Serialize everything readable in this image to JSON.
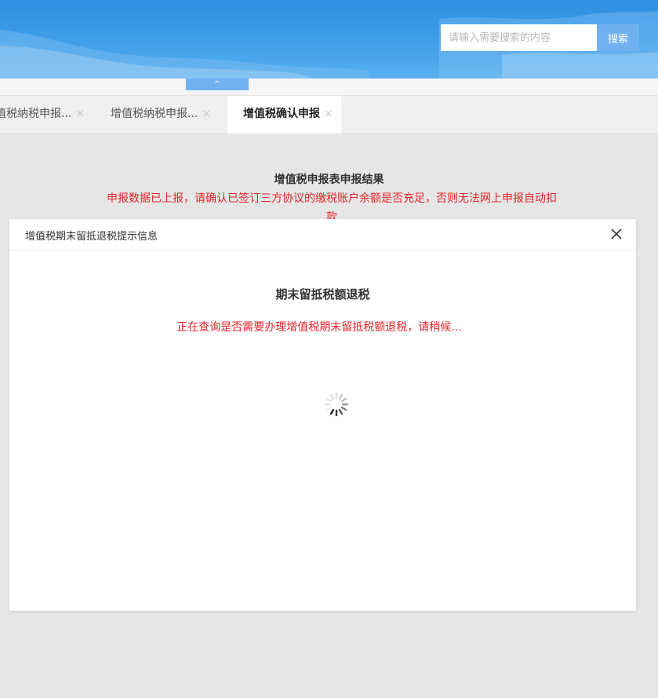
{
  "header": {
    "search": {
      "placeholder": "请输入需要搜索的内容",
      "button_label": "搜索"
    },
    "collapse_label": "^"
  },
  "tabs": [
    {
      "label": "值税纳税申报...",
      "close": "×"
    },
    {
      "label": "增值税纳税申报...",
      "close": "×"
    },
    {
      "label": "增值税确认申报",
      "close": "×",
      "active": true
    }
  ],
  "result": {
    "title": "增值税申报表申报结果",
    "message": "申报数据已上报，请确认已签订三方协议的缴税账户余额是否充足，否则无法网上申报自动扣款"
  },
  "modal": {
    "title": "增值税期末留抵退税提示信息",
    "heading": "期末留抵税额退税",
    "message": "正在查询是否需要办理增值税期末留抵税额退税，请稍候..."
  },
  "colors": {
    "accent": "#6fb2ef",
    "header_blue": "#3a9be8",
    "error_red": "#e4252a"
  },
  "icons": [
    "close-icon",
    "loading-spinner-icon"
  ]
}
